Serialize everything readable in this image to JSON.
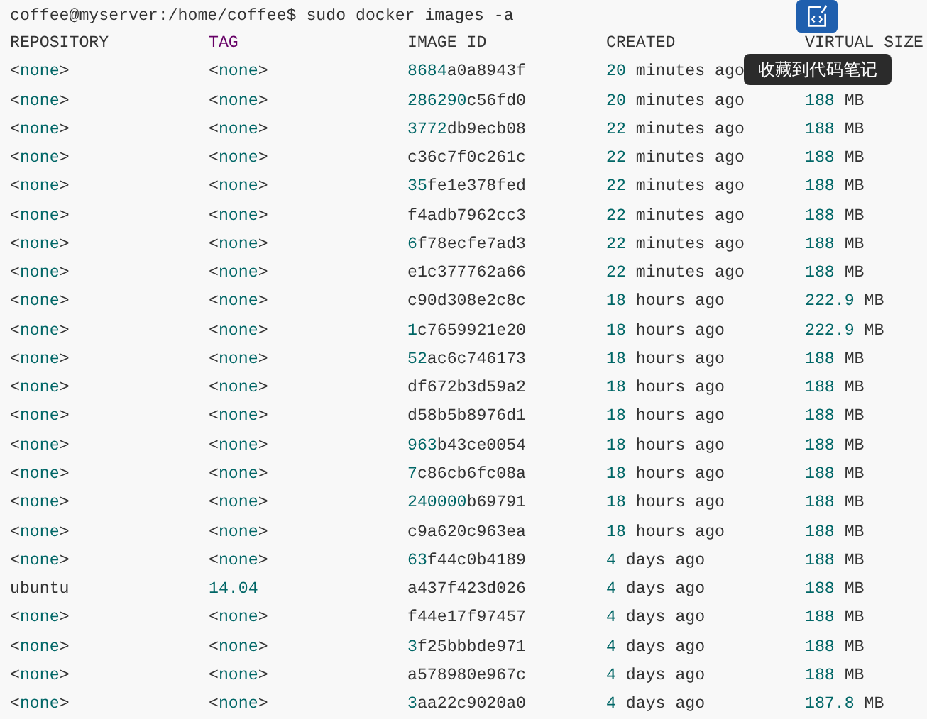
{
  "command": "coffee@myserver:/home/coffee$ sudo docker images -a",
  "columns": [
    {
      "text": "REPOSITORY",
      "kind": "plain"
    },
    {
      "text": "TAG",
      "kind": "tag"
    },
    {
      "text": "IMAGE ID",
      "kind": "plain"
    },
    {
      "text": "CREATED",
      "kind": "plain"
    },
    {
      "text": "VIRTUAL SIZE",
      "kind": "plain"
    }
  ],
  "rows": [
    [
      [
        {
          "text": "<",
          "kind": "plain"
        },
        {
          "text": "none",
          "kind": "keyword"
        },
        {
          "text": ">",
          "kind": "plain"
        }
      ],
      [
        {
          "text": "<",
          "kind": "plain"
        },
        {
          "text": "none",
          "kind": "keyword"
        },
        {
          "text": ">",
          "kind": "plain"
        }
      ],
      [
        {
          "text": "8684",
          "kind": "number"
        },
        {
          "text": "a0a8943f",
          "kind": "plain"
        }
      ],
      [
        {
          "text": "20",
          "kind": "number"
        },
        {
          "text": " minutes ago",
          "kind": "plain"
        }
      ]
    ],
    [
      [
        {
          "text": "<",
          "kind": "plain"
        },
        {
          "text": "none",
          "kind": "keyword"
        },
        {
          "text": ">",
          "kind": "plain"
        }
      ],
      [
        {
          "text": "<",
          "kind": "plain"
        },
        {
          "text": "none",
          "kind": "keyword"
        },
        {
          "text": ">",
          "kind": "plain"
        }
      ],
      [
        {
          "text": "286290",
          "kind": "number"
        },
        {
          "text": "c56fd0",
          "kind": "plain"
        }
      ],
      [
        {
          "text": "20",
          "kind": "number"
        },
        {
          "text": " minutes ago",
          "kind": "plain"
        }
      ],
      [
        {
          "text": "188",
          "kind": "number"
        },
        {
          "text": " MB",
          "kind": "plain"
        }
      ]
    ],
    [
      [
        {
          "text": "<",
          "kind": "plain"
        },
        {
          "text": "none",
          "kind": "keyword"
        },
        {
          "text": ">",
          "kind": "plain"
        }
      ],
      [
        {
          "text": "<",
          "kind": "plain"
        },
        {
          "text": "none",
          "kind": "keyword"
        },
        {
          "text": ">",
          "kind": "plain"
        }
      ],
      [
        {
          "text": "3772",
          "kind": "number"
        },
        {
          "text": "db9ecb08",
          "kind": "plain"
        }
      ],
      [
        {
          "text": "22",
          "kind": "number"
        },
        {
          "text": " minutes ago",
          "kind": "plain"
        }
      ],
      [
        {
          "text": "188",
          "kind": "number"
        },
        {
          "text": " MB",
          "kind": "plain"
        }
      ]
    ],
    [
      [
        {
          "text": "<",
          "kind": "plain"
        },
        {
          "text": "none",
          "kind": "keyword"
        },
        {
          "text": ">",
          "kind": "plain"
        }
      ],
      [
        {
          "text": "<",
          "kind": "plain"
        },
        {
          "text": "none",
          "kind": "keyword"
        },
        {
          "text": ">",
          "kind": "plain"
        }
      ],
      [
        {
          "text": "c36c7f0c261c",
          "kind": "plain"
        }
      ],
      [
        {
          "text": "22",
          "kind": "number"
        },
        {
          "text": " minutes ago",
          "kind": "plain"
        }
      ],
      [
        {
          "text": "188",
          "kind": "number"
        },
        {
          "text": " MB",
          "kind": "plain"
        }
      ]
    ],
    [
      [
        {
          "text": "<",
          "kind": "plain"
        },
        {
          "text": "none",
          "kind": "keyword"
        },
        {
          "text": ">",
          "kind": "plain"
        }
      ],
      [
        {
          "text": "<",
          "kind": "plain"
        },
        {
          "text": "none",
          "kind": "keyword"
        },
        {
          "text": ">",
          "kind": "plain"
        }
      ],
      [
        {
          "text": "35",
          "kind": "number"
        },
        {
          "text": "fe1e378fed",
          "kind": "plain"
        }
      ],
      [
        {
          "text": "22",
          "kind": "number"
        },
        {
          "text": " minutes ago",
          "kind": "plain"
        }
      ],
      [
        {
          "text": "188",
          "kind": "number"
        },
        {
          "text": " MB",
          "kind": "plain"
        }
      ]
    ],
    [
      [
        {
          "text": "<",
          "kind": "plain"
        },
        {
          "text": "none",
          "kind": "keyword"
        },
        {
          "text": ">",
          "kind": "plain"
        }
      ],
      [
        {
          "text": "<",
          "kind": "plain"
        },
        {
          "text": "none",
          "kind": "keyword"
        },
        {
          "text": ">",
          "kind": "plain"
        }
      ],
      [
        {
          "text": "f4adb7962cc3",
          "kind": "plain"
        }
      ],
      [
        {
          "text": "22",
          "kind": "number"
        },
        {
          "text": " minutes ago",
          "kind": "plain"
        }
      ],
      [
        {
          "text": "188",
          "kind": "number"
        },
        {
          "text": " MB",
          "kind": "plain"
        }
      ]
    ],
    [
      [
        {
          "text": "<",
          "kind": "plain"
        },
        {
          "text": "none",
          "kind": "keyword"
        },
        {
          "text": ">",
          "kind": "plain"
        }
      ],
      [
        {
          "text": "<",
          "kind": "plain"
        },
        {
          "text": "none",
          "kind": "keyword"
        },
        {
          "text": ">",
          "kind": "plain"
        }
      ],
      [
        {
          "text": "6",
          "kind": "number"
        },
        {
          "text": "f78ecfe7ad3",
          "kind": "plain"
        }
      ],
      [
        {
          "text": "22",
          "kind": "number"
        },
        {
          "text": " minutes ago",
          "kind": "plain"
        }
      ],
      [
        {
          "text": "188",
          "kind": "number"
        },
        {
          "text": " MB",
          "kind": "plain"
        }
      ]
    ],
    [
      [
        {
          "text": "<",
          "kind": "plain"
        },
        {
          "text": "none",
          "kind": "keyword"
        },
        {
          "text": ">",
          "kind": "plain"
        }
      ],
      [
        {
          "text": "<",
          "kind": "plain"
        },
        {
          "text": "none",
          "kind": "keyword"
        },
        {
          "text": ">",
          "kind": "plain"
        }
      ],
      [
        {
          "text": "e1c377762a66",
          "kind": "plain"
        }
      ],
      [
        {
          "text": "22",
          "kind": "number"
        },
        {
          "text": " minutes ago",
          "kind": "plain"
        }
      ],
      [
        {
          "text": "188",
          "kind": "number"
        },
        {
          "text": " MB",
          "kind": "plain"
        }
      ]
    ],
    [
      [
        {
          "text": "<",
          "kind": "plain"
        },
        {
          "text": "none",
          "kind": "keyword"
        },
        {
          "text": ">",
          "kind": "plain"
        }
      ],
      [
        {
          "text": "<",
          "kind": "plain"
        },
        {
          "text": "none",
          "kind": "keyword"
        },
        {
          "text": ">",
          "kind": "plain"
        }
      ],
      [
        {
          "text": "c90d308e2c8c",
          "kind": "plain"
        }
      ],
      [
        {
          "text": "18",
          "kind": "number"
        },
        {
          "text": " hours ago",
          "kind": "plain"
        }
      ],
      [
        {
          "text": "222.9",
          "kind": "number"
        },
        {
          "text": " MB",
          "kind": "plain"
        }
      ]
    ],
    [
      [
        {
          "text": "<",
          "kind": "plain"
        },
        {
          "text": "none",
          "kind": "keyword"
        },
        {
          "text": ">",
          "kind": "plain"
        }
      ],
      [
        {
          "text": "<",
          "kind": "plain"
        },
        {
          "text": "none",
          "kind": "keyword"
        },
        {
          "text": ">",
          "kind": "plain"
        }
      ],
      [
        {
          "text": "1",
          "kind": "number"
        },
        {
          "text": "c7659921e20",
          "kind": "plain"
        }
      ],
      [
        {
          "text": "18",
          "kind": "number"
        },
        {
          "text": " hours ago",
          "kind": "plain"
        }
      ],
      [
        {
          "text": "222.9",
          "kind": "number"
        },
        {
          "text": " MB",
          "kind": "plain"
        }
      ]
    ],
    [
      [
        {
          "text": "<",
          "kind": "plain"
        },
        {
          "text": "none",
          "kind": "keyword"
        },
        {
          "text": ">",
          "kind": "plain"
        }
      ],
      [
        {
          "text": "<",
          "kind": "plain"
        },
        {
          "text": "none",
          "kind": "keyword"
        },
        {
          "text": ">",
          "kind": "plain"
        }
      ],
      [
        {
          "text": "52",
          "kind": "number"
        },
        {
          "text": "ac6c746173",
          "kind": "plain"
        }
      ],
      [
        {
          "text": "18",
          "kind": "number"
        },
        {
          "text": " hours ago",
          "kind": "plain"
        }
      ],
      [
        {
          "text": "188",
          "kind": "number"
        },
        {
          "text": " MB",
          "kind": "plain"
        }
      ]
    ],
    [
      [
        {
          "text": "<",
          "kind": "plain"
        },
        {
          "text": "none",
          "kind": "keyword"
        },
        {
          "text": ">",
          "kind": "plain"
        }
      ],
      [
        {
          "text": "<",
          "kind": "plain"
        },
        {
          "text": "none",
          "kind": "keyword"
        },
        {
          "text": ">",
          "kind": "plain"
        }
      ],
      [
        {
          "text": "df672b3d59a2",
          "kind": "plain"
        }
      ],
      [
        {
          "text": "18",
          "kind": "number"
        },
        {
          "text": " hours ago",
          "kind": "plain"
        }
      ],
      [
        {
          "text": "188",
          "kind": "number"
        },
        {
          "text": " MB",
          "kind": "plain"
        }
      ]
    ],
    [
      [
        {
          "text": "<",
          "kind": "plain"
        },
        {
          "text": "none",
          "kind": "keyword"
        },
        {
          "text": ">",
          "kind": "plain"
        }
      ],
      [
        {
          "text": "<",
          "kind": "plain"
        },
        {
          "text": "none",
          "kind": "keyword"
        },
        {
          "text": ">",
          "kind": "plain"
        }
      ],
      [
        {
          "text": "d58b5b8976d1",
          "kind": "plain"
        }
      ],
      [
        {
          "text": "18",
          "kind": "number"
        },
        {
          "text": " hours ago",
          "kind": "plain"
        }
      ],
      [
        {
          "text": "188",
          "kind": "number"
        },
        {
          "text": " MB",
          "kind": "plain"
        }
      ]
    ],
    [
      [
        {
          "text": "<",
          "kind": "plain"
        },
        {
          "text": "none",
          "kind": "keyword"
        },
        {
          "text": ">",
          "kind": "plain"
        }
      ],
      [
        {
          "text": "<",
          "kind": "plain"
        },
        {
          "text": "none",
          "kind": "keyword"
        },
        {
          "text": ">",
          "kind": "plain"
        }
      ],
      [
        {
          "text": "963",
          "kind": "number"
        },
        {
          "text": "b43ce0054",
          "kind": "plain"
        }
      ],
      [
        {
          "text": "18",
          "kind": "number"
        },
        {
          "text": " hours ago",
          "kind": "plain"
        }
      ],
      [
        {
          "text": "188",
          "kind": "number"
        },
        {
          "text": " MB",
          "kind": "plain"
        }
      ]
    ],
    [
      [
        {
          "text": "<",
          "kind": "plain"
        },
        {
          "text": "none",
          "kind": "keyword"
        },
        {
          "text": ">",
          "kind": "plain"
        }
      ],
      [
        {
          "text": "<",
          "kind": "plain"
        },
        {
          "text": "none",
          "kind": "keyword"
        },
        {
          "text": ">",
          "kind": "plain"
        }
      ],
      [
        {
          "text": "7",
          "kind": "number"
        },
        {
          "text": "c86cb6fc08a",
          "kind": "plain"
        }
      ],
      [
        {
          "text": "18",
          "kind": "number"
        },
        {
          "text": " hours ago",
          "kind": "plain"
        }
      ],
      [
        {
          "text": "188",
          "kind": "number"
        },
        {
          "text": " MB",
          "kind": "plain"
        }
      ]
    ],
    [
      [
        {
          "text": "<",
          "kind": "plain"
        },
        {
          "text": "none",
          "kind": "keyword"
        },
        {
          "text": ">",
          "kind": "plain"
        }
      ],
      [
        {
          "text": "<",
          "kind": "plain"
        },
        {
          "text": "none",
          "kind": "keyword"
        },
        {
          "text": ">",
          "kind": "plain"
        }
      ],
      [
        {
          "text": "240000",
          "kind": "number"
        },
        {
          "text": "b69791",
          "kind": "plain"
        }
      ],
      [
        {
          "text": "18",
          "kind": "number"
        },
        {
          "text": " hours ago",
          "kind": "plain"
        }
      ],
      [
        {
          "text": "188",
          "kind": "number"
        },
        {
          "text": " MB",
          "kind": "plain"
        }
      ]
    ],
    [
      [
        {
          "text": "<",
          "kind": "plain"
        },
        {
          "text": "none",
          "kind": "keyword"
        },
        {
          "text": ">",
          "kind": "plain"
        }
      ],
      [
        {
          "text": "<",
          "kind": "plain"
        },
        {
          "text": "none",
          "kind": "keyword"
        },
        {
          "text": ">",
          "kind": "plain"
        }
      ],
      [
        {
          "text": "c9a620c963ea",
          "kind": "plain"
        }
      ],
      [
        {
          "text": "18",
          "kind": "number"
        },
        {
          "text": " hours ago",
          "kind": "plain"
        }
      ],
      [
        {
          "text": "188",
          "kind": "number"
        },
        {
          "text": " MB",
          "kind": "plain"
        }
      ]
    ],
    [
      [
        {
          "text": "<",
          "kind": "plain"
        },
        {
          "text": "none",
          "kind": "keyword"
        },
        {
          "text": ">",
          "kind": "plain"
        }
      ],
      [
        {
          "text": "<",
          "kind": "plain"
        },
        {
          "text": "none",
          "kind": "keyword"
        },
        {
          "text": ">",
          "kind": "plain"
        }
      ],
      [
        {
          "text": "63",
          "kind": "number"
        },
        {
          "text": "f44c0b4189",
          "kind": "plain"
        }
      ],
      [
        {
          "text": "4",
          "kind": "number"
        },
        {
          "text": " days ago",
          "kind": "plain"
        }
      ],
      [
        {
          "text": "188",
          "kind": "number"
        },
        {
          "text": " MB",
          "kind": "plain"
        }
      ]
    ],
    [
      [
        {
          "text": "ubuntu",
          "kind": "plain"
        }
      ],
      [
        {
          "text": "14.04",
          "kind": "number"
        }
      ],
      [
        {
          "text": "a437f423d026",
          "kind": "plain"
        }
      ],
      [
        {
          "text": "4",
          "kind": "number"
        },
        {
          "text": " days ago",
          "kind": "plain"
        }
      ],
      [
        {
          "text": "188",
          "kind": "number"
        },
        {
          "text": " MB",
          "kind": "plain"
        }
      ]
    ],
    [
      [
        {
          "text": "<",
          "kind": "plain"
        },
        {
          "text": "none",
          "kind": "keyword"
        },
        {
          "text": ">",
          "kind": "plain"
        }
      ],
      [
        {
          "text": "<",
          "kind": "plain"
        },
        {
          "text": "none",
          "kind": "keyword"
        },
        {
          "text": ">",
          "kind": "plain"
        }
      ],
      [
        {
          "text": "f44e17f97457",
          "kind": "plain"
        }
      ],
      [
        {
          "text": "4",
          "kind": "number"
        },
        {
          "text": " days ago",
          "kind": "plain"
        }
      ],
      [
        {
          "text": "188",
          "kind": "number"
        },
        {
          "text": " MB",
          "kind": "plain"
        }
      ]
    ],
    [
      [
        {
          "text": "<",
          "kind": "plain"
        },
        {
          "text": "none",
          "kind": "keyword"
        },
        {
          "text": ">",
          "kind": "plain"
        }
      ],
      [
        {
          "text": "<",
          "kind": "plain"
        },
        {
          "text": "none",
          "kind": "keyword"
        },
        {
          "text": ">",
          "kind": "plain"
        }
      ],
      [
        {
          "text": "3",
          "kind": "number"
        },
        {
          "text": "f25bbbde971",
          "kind": "plain"
        }
      ],
      [
        {
          "text": "4",
          "kind": "number"
        },
        {
          "text": " days ago",
          "kind": "plain"
        }
      ],
      [
        {
          "text": "188",
          "kind": "number"
        },
        {
          "text": " MB",
          "kind": "plain"
        }
      ]
    ],
    [
      [
        {
          "text": "<",
          "kind": "plain"
        },
        {
          "text": "none",
          "kind": "keyword"
        },
        {
          "text": ">",
          "kind": "plain"
        }
      ],
      [
        {
          "text": "<",
          "kind": "plain"
        },
        {
          "text": "none",
          "kind": "keyword"
        },
        {
          "text": ">",
          "kind": "plain"
        }
      ],
      [
        {
          "text": "a578980e967c",
          "kind": "plain"
        }
      ],
      [
        {
          "text": "4",
          "kind": "number"
        },
        {
          "text": " days ago",
          "kind": "plain"
        }
      ],
      [
        {
          "text": "188",
          "kind": "number"
        },
        {
          "text": " MB",
          "kind": "plain"
        }
      ]
    ],
    [
      [
        {
          "text": "<",
          "kind": "plain"
        },
        {
          "text": "none",
          "kind": "keyword"
        },
        {
          "text": ">",
          "kind": "plain"
        }
      ],
      [
        {
          "text": "<",
          "kind": "plain"
        },
        {
          "text": "none",
          "kind": "keyword"
        },
        {
          "text": ">",
          "kind": "plain"
        }
      ],
      [
        {
          "text": "3",
          "kind": "number"
        },
        {
          "text": "aa22c9020a0",
          "kind": "plain"
        }
      ],
      [
        {
          "text": "4",
          "kind": "number"
        },
        {
          "text": " days ago",
          "kind": "plain"
        }
      ],
      [
        {
          "text": "187.8",
          "kind": "number"
        },
        {
          "text": " MB",
          "kind": "plain"
        }
      ]
    ]
  ],
  "tooltip": "收藏到代码笔记"
}
